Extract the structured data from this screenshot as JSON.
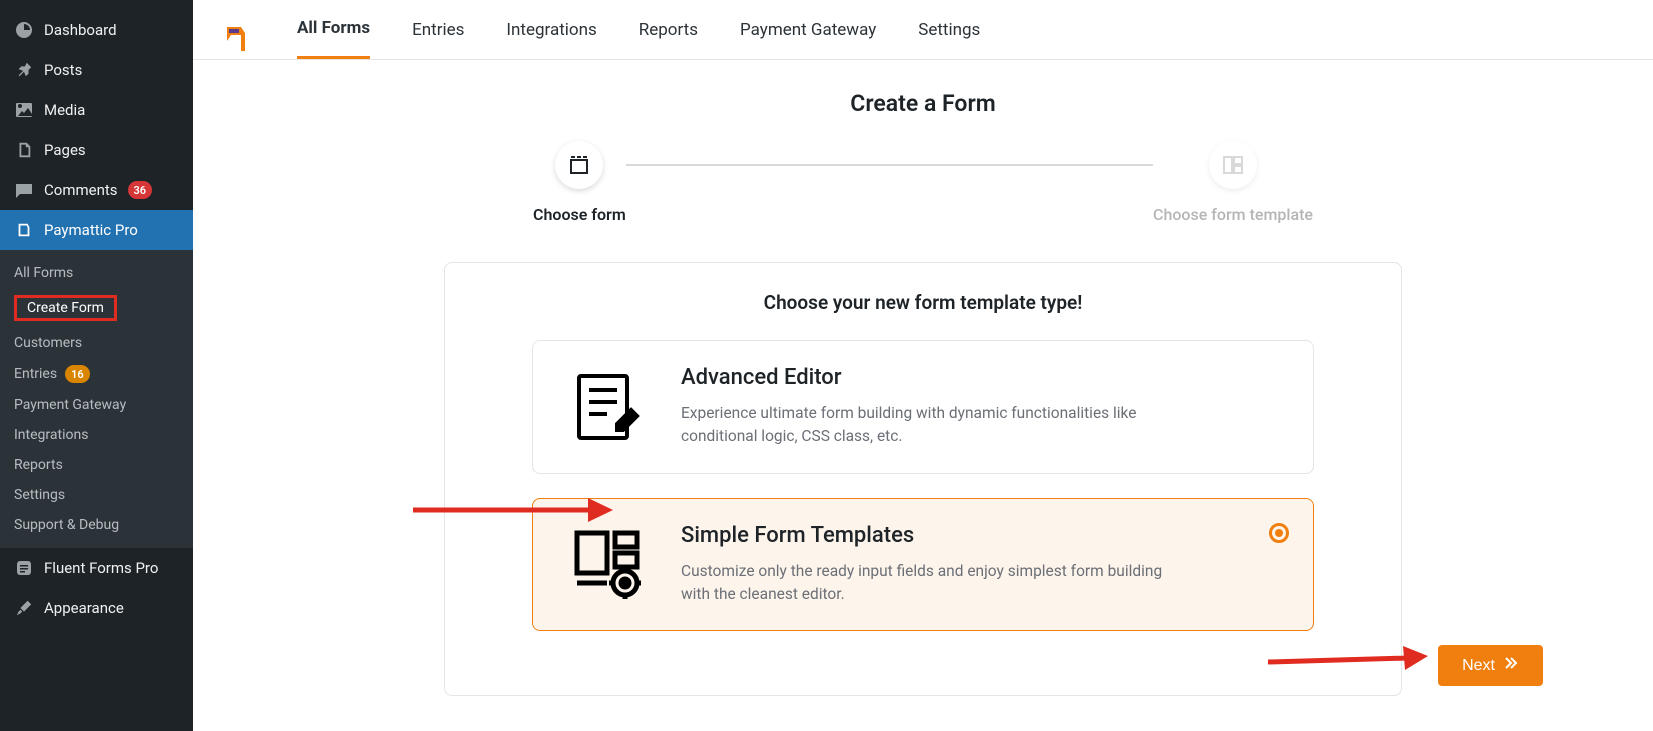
{
  "sidebar": {
    "dashboard": "Dashboard",
    "posts": "Posts",
    "media": "Media",
    "pages": "Pages",
    "comments": "Comments",
    "comments_count": "36",
    "paymattic": "Paymattic Pro",
    "submenu": {
      "all_forms": "All Forms",
      "create_form": "Create Form",
      "customers": "Customers",
      "entries": "Entries",
      "entries_count": "16",
      "payment_gateway": "Payment Gateway",
      "integrations": "Integrations",
      "reports": "Reports",
      "settings": "Settings",
      "support": "Support & Debug"
    },
    "fluent_forms": "Fluent Forms Pro",
    "appearance": "Appearance"
  },
  "topnav": {
    "all_forms": "All Forms",
    "entries": "Entries",
    "integrations": "Integrations",
    "reports": "Reports",
    "payment_gateway": "Payment Gateway",
    "settings": "Settings"
  },
  "page": {
    "title": "Create a Form",
    "step1": "Choose form",
    "step2": "Choose form template",
    "card_heading": "Choose your new form template type!",
    "option1_title": "Advanced Editor",
    "option1_desc": "Experience ultimate form building with dynamic functionalities like conditional logic, CSS class, etc.",
    "option2_title": "Simple Form Templates",
    "option2_desc": "Customize only the ready input fields and enjoy simplest form building with the cleanest editor.",
    "next": "Next"
  }
}
